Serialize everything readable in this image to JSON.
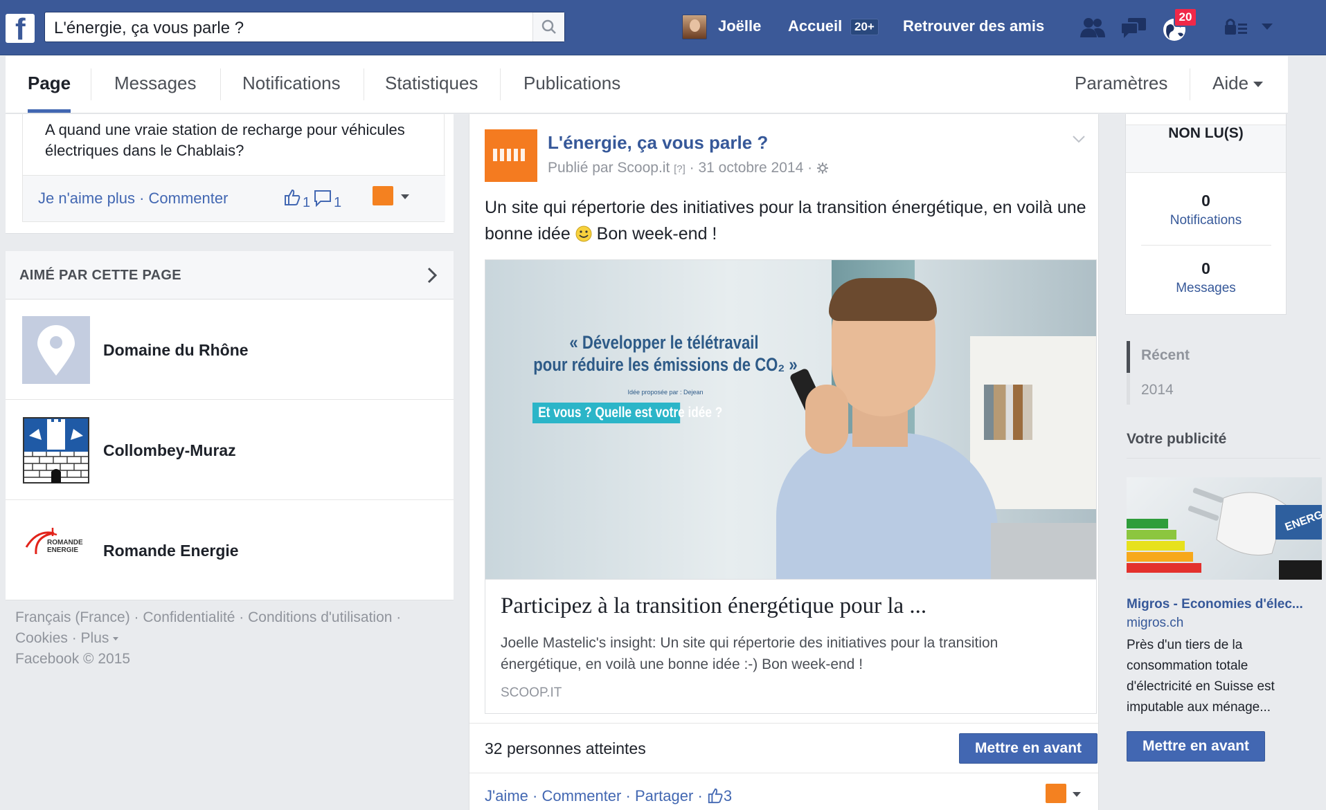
{
  "topbar": {
    "logo": "f",
    "search_value": "L'énergie, ça vous parle ?",
    "user_name": "Joëlle",
    "home_label": "Accueil",
    "home_count": "20+",
    "find_friends_label": "Retrouver des amis",
    "notifications_count": "20",
    "icons": [
      "friend-requests-icon",
      "messages-icon",
      "notifications-globe-icon",
      "privacy-lock-icon",
      "account-chevron-down-icon"
    ]
  },
  "tabs": {
    "page": "Page",
    "messages": "Messages",
    "notifications": "Notifications",
    "insights": "Statistiques",
    "publishing_tools": "Publications",
    "settings": "Paramètres",
    "help": "Aide"
  },
  "comment_card": {
    "text": "A quand une vraie station de recharge pour véhicules électriques dans le Chablais?",
    "unlike": "Je n'aime plus",
    "separator": " · ",
    "comment": "Commenter",
    "likes": "1",
    "comments": "1"
  },
  "liked_by_page": {
    "title": "AIMÉ PAR CETTE PAGE",
    "items": [
      {
        "name": "Domaine du Rhône"
      },
      {
        "name": "Collombey-Muraz"
      },
      {
        "name": "Romande Energie",
        "logo_text": "ROMANDE ENERGIE"
      }
    ]
  },
  "footer": {
    "language": "Français (France)",
    "privacy": "Confidentialité",
    "terms": "Conditions d'utilisation",
    "cookies": "Cookies",
    "more": "Plus",
    "sep": " · ",
    "copyright": "Facebook © 2015"
  },
  "post": {
    "page_name": "L'énergie, ça vous parle ?",
    "meta_published": "Publié par Scoop.it",
    "meta_help": "[?]",
    "meta_date": "31 octobre 2014",
    "meta_sep": " · ",
    "text_before_emoji": "Un site qui répertorie des initiatives pour la transition énergétique, en voilà une bonne idée",
    "text_after_emoji": "Bon week-end !",
    "link": {
      "image_quote_line1": "« Développer le télétravail",
      "image_quote_line2": "pour réduire les émissions de CO₂ »",
      "image_small": "Idée proposée par : Dejean",
      "image_cta": "Et vous ? Quelle est votre idée ?",
      "headline": "Participez à la transition énergétique pour la ...",
      "description": "Joelle Mastelic's insight: Un site qui répertorie des initiatives pour la transition énergétique, en voilà une bonne idée :-) Bon week-end !",
      "domain": "SCOOP.IT"
    },
    "reach": "32 personnes atteintes",
    "boost_label": "Mettre en avant",
    "action_like": "J'aime",
    "action_comment": "Commenter",
    "action_share": "Partager",
    "action_sep": " · ",
    "like_count": "3"
  },
  "right": {
    "unread_title": "NON LU(S)",
    "notifications_count": "0",
    "notifications_label": "Notifications",
    "messages_count": "0",
    "messages_label": "Messages",
    "recent_label": "Récent",
    "year_label": "2014",
    "ad_header": "Votre publicité",
    "ad_title": "Migros - Economies d'élec...",
    "ad_domain": "migros.ch",
    "ad_text": "Près d'un tiers de la consommation totale d'électricité en Suisse est imputable aux ménage...",
    "ad_boost": "Mettre en avant",
    "ad_image_text": "ENERG"
  },
  "colors": {
    "brand_blue": "#3b5998",
    "button_blue": "#4267b2",
    "badge_red": "#f02849",
    "scoop_orange": "#f47b20"
  }
}
